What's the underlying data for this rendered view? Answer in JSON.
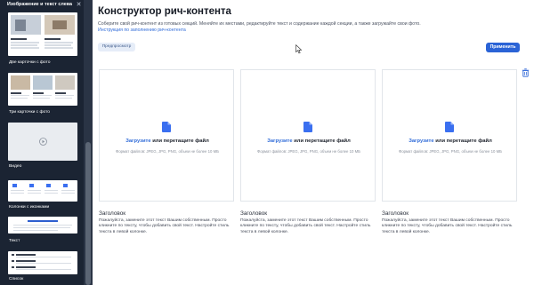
{
  "sidebar": {
    "header": "Изображение и текст слева",
    "close_icon": "close-icon",
    "items": [
      {
        "label": "Две карточки с фото"
      },
      {
        "label": "Три карточки с фото"
      },
      {
        "label": "Видео",
        "icon": "play-icon"
      },
      {
        "label": "Колонки с иконками"
      },
      {
        "label": "Текст"
      },
      {
        "label": "Список"
      }
    ]
  },
  "main": {
    "title": "Конструктор рич-контента",
    "subtitle": "Соберите свой рич-контент из готовых секций. Меняйте их местами, редактируйте текст и содержание каждой секции, а также загружайте свои фото.",
    "instruction_link": "Инструкция по заполнению рич-контента",
    "preview_button": "Предпросмотр",
    "apply_button": "Применить",
    "delete_icon": "trash-icon",
    "cards": [
      {
        "upload_link": "Загрузите",
        "upload_rest": " или перетащите файл",
        "formats": "Формат файлов: JPEG, JPG, PNG, объем не более 10 МБ",
        "heading": "Заголовок",
        "text": "Пожалуйста, замените этот текст Вашим собственным. Просто кликните по тексту, чтобы добавить свой текст. Настройте стиль текста в левой колонке."
      },
      {
        "upload_link": "Загрузите",
        "upload_rest": " или перетащите файл",
        "formats": "Формат файлов: JPEG, JPG, PNG, объем не более 10 МБ",
        "heading": "Заголовок",
        "text": "Пожалуйста, замените этот текст Вашим собственным. Просто кликните по тексту, чтобы добавить свой текст. Настройте стиль текста в левой колонке."
      },
      {
        "upload_link": "Загрузите",
        "upload_rest": " или перетащите файл",
        "formats": "Формат файлов: JPEG, JPG, PNG, объем не более 10 МБ",
        "heading": "Заголовок",
        "text": "Пожалуйста, замените этот текст Вашим собственным. Просто кликните по тексту, чтобы добавить свой текст. Настройте стиль текста в левой колонке."
      }
    ]
  },
  "colors": {
    "sidebar_bg": "#1b2433",
    "accent": "#2a63d6",
    "link": "#2f6bd8",
    "file_icon": "#3a6ff0"
  }
}
